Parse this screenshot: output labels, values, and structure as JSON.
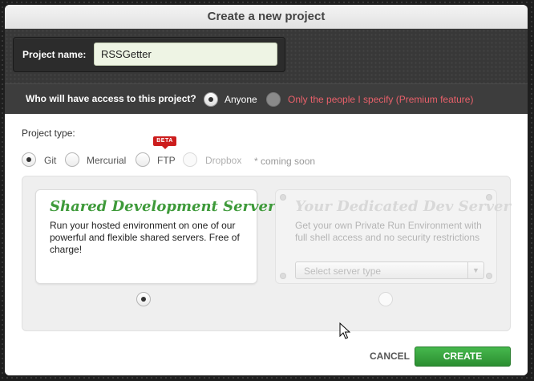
{
  "dialog": {
    "title": "Create a new project"
  },
  "project_name": {
    "label": "Project name:",
    "value": "RSSGetter"
  },
  "access": {
    "question": "Who will have access to this project?",
    "options": [
      {
        "label": "Anyone",
        "selected": true,
        "color": "#ffffff"
      },
      {
        "label": "Only the people I specify (Premium feature)",
        "selected": false,
        "color": "#e8606a"
      }
    ]
  },
  "project_type": {
    "label": "Project type:",
    "options": [
      {
        "label": "Git",
        "selected": true,
        "disabled": false
      },
      {
        "label": "Mercurial",
        "selected": false,
        "disabled": false
      },
      {
        "label": "FTP",
        "selected": false,
        "disabled": false,
        "badge": "BETA"
      },
      {
        "label": "Dropbox",
        "selected": false,
        "disabled": true
      }
    ],
    "coming_soon": "* coming soon"
  },
  "servers": {
    "shared": {
      "title": "Shared Development Server",
      "description": "Run your hosted environment on one of our powerful and flexible shared servers. Free of charge!",
      "selected": true
    },
    "dedicated": {
      "title": "Your Dedicated Dev Server",
      "description": "Get your own Private Run Environment with full shell access and no security restrictions",
      "select_placeholder": "Select server type",
      "selected": false
    }
  },
  "actions": {
    "cancel": "CANCEL",
    "create": "CREATE"
  },
  "colors": {
    "accent_green": "#3e9a3a",
    "button_green": "#35a13c",
    "premium_red": "#e8606a",
    "beta_red": "#cc1d1d"
  }
}
